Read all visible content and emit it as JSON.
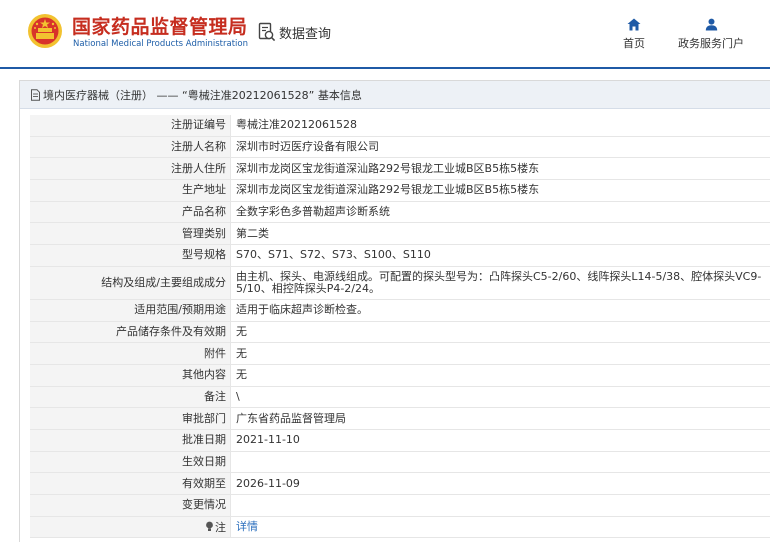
{
  "header": {
    "site_title": "国家药品监督管理局",
    "site_subtitle": "National Medical Products Administration",
    "query_label": "数据查询",
    "nav": {
      "home": "首页",
      "portal": "政务服务门户"
    }
  },
  "colors": {
    "brand_red": "#c62d1f",
    "brand_blue": "#1f5aa6",
    "link": "#2a6ebd"
  },
  "breadcrumb": "境内医疗器械（注册） —— “粤械注准20212061528” 基本信息",
  "rows": [
    {
      "label": "注册证编号",
      "value": "粤械注准20212061528"
    },
    {
      "label": "注册人名称",
      "value": "深圳市时迈医疗设备有限公司"
    },
    {
      "label": "注册人住所",
      "value": "深圳市龙岗区宝龙街道深汕路292号银龙工业城B区B5栋5楼东"
    },
    {
      "label": "生产地址",
      "value": "深圳市龙岗区宝龙街道深汕路292号银龙工业城B区B5栋5楼东"
    },
    {
      "label": "产品名称",
      "value": "全数字彩色多普勒超声诊断系统"
    },
    {
      "label": "管理类别",
      "value": "第二类"
    },
    {
      "label": "型号规格",
      "value": "S70、S71、S72、S73、S100、S110"
    },
    {
      "label": "结构及组成/主要组成成分",
      "value": "由主机、探头、电源线组成。可配置的探头型号为：凸阵探头C5-2/60、线阵探头L14-5/38、腔体探头VC9-5/10、相控阵探头P4-2/24。"
    },
    {
      "label": "适用范围/预期用途",
      "value": "适用于临床超声诊断检查。"
    },
    {
      "label": "产品储存条件及有效期",
      "value": "无"
    },
    {
      "label": "附件",
      "value": "无"
    },
    {
      "label": "其他内容",
      "value": "无"
    },
    {
      "label": "备注",
      "value": "\\"
    },
    {
      "label": "审批部门",
      "value": "广东省药品监督管理局"
    },
    {
      "label": "批准日期",
      "value": "2021-11-10"
    },
    {
      "label": "生效日期",
      "value": ""
    },
    {
      "label": "有效期至",
      "value": "2026-11-09"
    },
    {
      "label": "变更情况",
      "value": ""
    },
    {
      "label": "注",
      "value": "详情"
    }
  ]
}
